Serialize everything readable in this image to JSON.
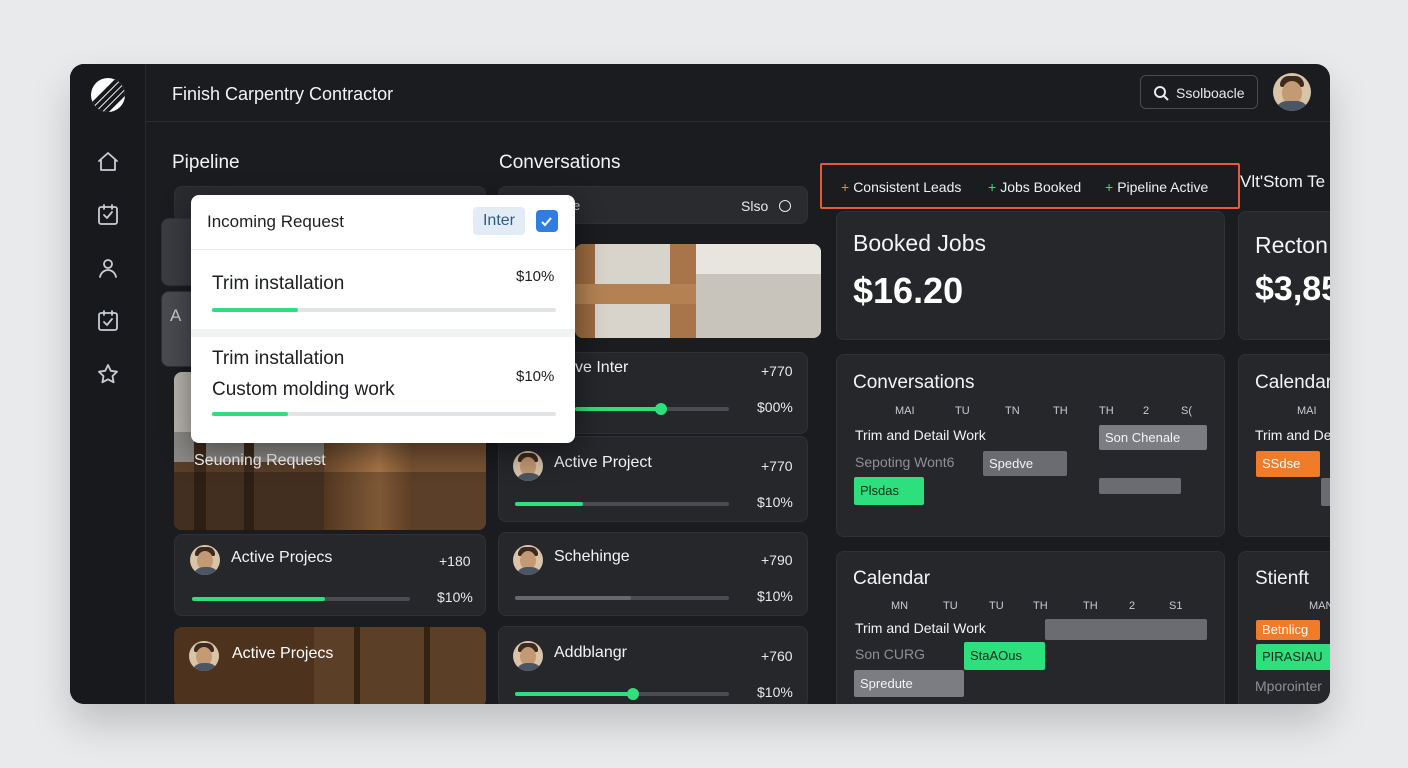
{
  "app": {
    "title": "Finish Carpentry Contractor"
  },
  "search": {
    "label": "Ssolboacle"
  },
  "nav": [
    "home-icon",
    "checklist-icon",
    "user-icon",
    "calendar-check-icon",
    "star-icon"
  ],
  "pipeline": {
    "heading": "Pipeline",
    "popup": {
      "title": "Incoming Request",
      "badge": "Inter",
      "item1": {
        "label": "Trim installation",
        "value": "$10%",
        "progress": 0.25
      },
      "item2": {
        "line1": "Trim installation",
        "line2": "Custom molding work",
        "value": "$10%",
        "progress": 0.22
      }
    },
    "image_caption": "Seuoning Request",
    "cards": [
      {
        "name": "Active Projecs",
        "count": "+180",
        "value": "$10%",
        "progress": 0.61
      },
      {
        "name": "Active Projecs"
      }
    ],
    "side_letter": "A"
  },
  "conversations": {
    "heading": "Conversations",
    "search_text": "Slso",
    "search_left": "e",
    "cards": [
      {
        "name": "ve Inter",
        "count": "+770",
        "value": "$00%",
        "progress": 0.56
      },
      {
        "name": "Active Project",
        "count": "+770",
        "value": "$10%",
        "progress": 0.32
      },
      {
        "name": "Schehinge",
        "count": "+790",
        "value": "$10%",
        "progress": 0.54
      },
      {
        "name": "Addblangr",
        "count": "+760",
        "value": "$10%",
        "progress": 0.55
      }
    ]
  },
  "tags": {
    "t1": "Consistent Leads",
    "t2": "Jobs Booked",
    "t3": "Pipeline Active",
    "overflow": "Vlt'Stom Te"
  },
  "booked": {
    "title": "Booked Jobs",
    "value": "$16.20"
  },
  "recton": {
    "title": "Recton",
    "value": "$3,85"
  },
  "conv_panel": {
    "title": "Conversations",
    "days": [
      "MAI",
      "TU",
      "TN",
      "TH",
      "TH",
      "2",
      "S("
    ],
    "row1": "Trim and Detail Work",
    "row2": "Sepoting Wont6",
    "chips": {
      "c1": "Son Chenale",
      "c2": "Spedve",
      "c3": "Plsdas"
    }
  },
  "calendar_r": {
    "title": "Calendar",
    "day": "MAI",
    "row": "Trim and De",
    "chip": "SSdse"
  },
  "calendar": {
    "title": "Calendar",
    "days": [
      "MN",
      "TU",
      "TU",
      "TH",
      "TH",
      "2",
      "S1"
    ],
    "row1": "Trim and Detail Work",
    "row2": "Son CURG",
    "chips": {
      "c1": "StaAOus",
      "c2": "Spredute"
    }
  },
  "stienft": {
    "title": "Stienft",
    "day": "MAN",
    "c1": "Betnlicg",
    "c2": "PIRASIAU",
    "row": "Mporointer"
  }
}
